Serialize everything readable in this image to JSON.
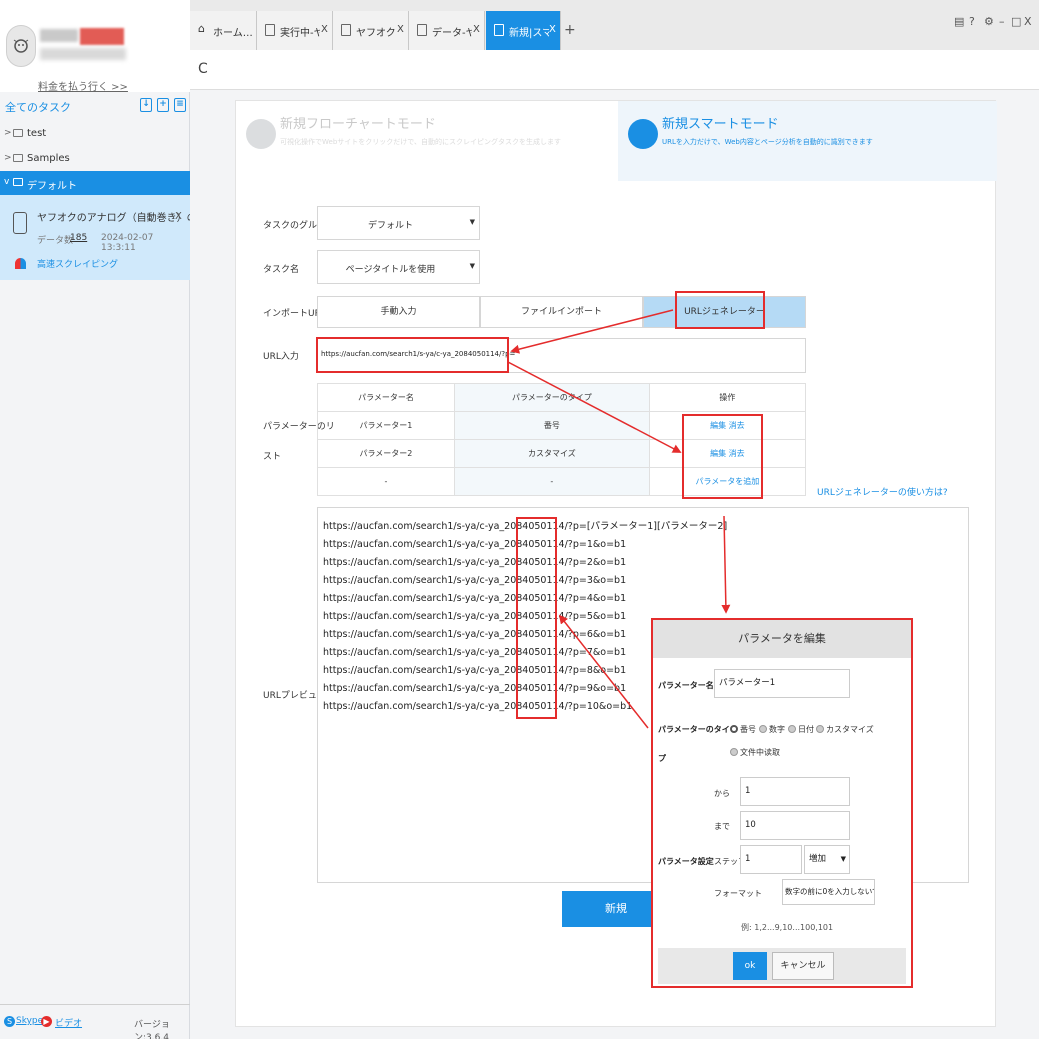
{
  "sidebar": {
    "pay_link": "料金を払う行く >>",
    "all_tasks": "全てのタスク",
    "tree": [
      {
        "label": "test"
      },
      {
        "label": "Samples"
      },
      {
        "label": "デフォルト"
      }
    ],
    "task": {
      "title": "ヤフオクのアナログ（自動巻き）の相場・…",
      "data_label": "データ数",
      "data_count": "185",
      "date": "2024-02-07 13:3:11",
      "fast_label": "高速スクレイピング",
      "close": "X"
    },
    "footer": {
      "skype": "Skype",
      "video": "ビデオ",
      "version": "バージョン:3.6.4"
    }
  },
  "tabs": [
    {
      "label": "ホーム…",
      "close": ""
    },
    {
      "label": "実行中-ヤフ…",
      "close": "X"
    },
    {
      "label": "ヤフオクのアナ…",
      "close": "X"
    },
    {
      "label": "データ-ヤフ…",
      "close": "X"
    },
    {
      "label": "新規|スマ…",
      "close": "X"
    }
  ],
  "tab_add": "+",
  "window_controls": [
    "▤",
    "?",
    "⚙",
    "–",
    "□",
    "X"
  ],
  "reload": "C",
  "modes": {
    "flow_title": "新規フローチャートモード",
    "flow_desc": "可視化操作でWebサイトをクリックだけで、自動的にスクレイピングタスクを生成します",
    "smart_title": "新規スマートモード",
    "smart_desc": "URLを入力だけで、Web内容とページ分析を自動的に識別できます"
  },
  "form": {
    "group_label": "タスクのグループ",
    "group_value": "デフォルト",
    "name_label": "タスク名",
    "name_value": "ページタイトルを使用",
    "import_label": "インポートURL",
    "import_options": [
      "手動入力",
      "ファイルインポート",
      "URLジェネレーター"
    ],
    "url_label": "URL入力",
    "url_value": "https://aucfan.com/search1/s-ya/c-ya_2084050114/?p=",
    "param_list_label_1": "パラメーターのリ",
    "param_list_label_2": "スト",
    "table_headers": [
      "パラメーター名",
      "パラメーターのタイプ",
      "操作"
    ],
    "table_rows": [
      {
        "name": "パラメーター1",
        "type": "番号",
        "edit": "編集",
        "delete": "消去"
      },
      {
        "name": "パラメーター2",
        "type": "カスタマイズ",
        "edit": "編集",
        "delete": "消去"
      }
    ],
    "empty_row": {
      "name": "-",
      "type": "-",
      "add": "パラメータを追加"
    },
    "howto": "URLジェネレーターの使い方は?",
    "preview_label": "URLプレビュー",
    "preview_lines": [
      "https://aucfan.com/search1/s-ya/c-ya_2084050114/?p=[パラメーター1][パラメーター2]",
      "https://aucfan.com/search1/s-ya/c-ya_2084050114/?p=1&o=b1",
      "https://aucfan.com/search1/s-ya/c-ya_2084050114/?p=2&o=b1",
      "https://aucfan.com/search1/s-ya/c-ya_2084050114/?p=3&o=b1",
      "https://aucfan.com/search1/s-ya/c-ya_2084050114/?p=4&o=b1",
      "https://aucfan.com/search1/s-ya/c-ya_2084050114/?p=5&o=b1",
      "https://aucfan.com/search1/s-ya/c-ya_2084050114/?p=6&o=b1",
      "https://aucfan.com/search1/s-ya/c-ya_2084050114/?p=7&o=b1",
      "https://aucfan.com/search1/s-ya/c-ya_2084050114/?p=8&o=b1",
      "https://aucfan.com/search1/s-ya/c-ya_2084050114/?p=9&o=b1",
      "https://aucfan.com/search1/s-ya/c-ya_2084050114/?p=10&o=b1"
    ],
    "new_button": "新規"
  },
  "dialog": {
    "title": "パラメータを編集",
    "name_label": "パラメーター名",
    "name_value": "パラメーター1",
    "type_label_1": "パラメーターのタイ",
    "type_label_2": "プ",
    "types": [
      "番号",
      "数字",
      "日付",
      "カスタマイズ",
      "文件中读取"
    ],
    "settings_label": "パラメータ設定",
    "from_label": "から",
    "from_value": "1",
    "to_label": "まで",
    "to_value": "10",
    "step_label": "ステップ",
    "step_value": "1",
    "step_mode": "増加",
    "format_label": "フォーマット",
    "format_value": "数字の前に0を入力しないでください",
    "example": "例: 1,2...9,10...100,101",
    "ok": "ok",
    "cancel": "キャンセル"
  },
  "colors": {
    "accent": "#1a8fe3",
    "annotation": "#e42c2c"
  }
}
